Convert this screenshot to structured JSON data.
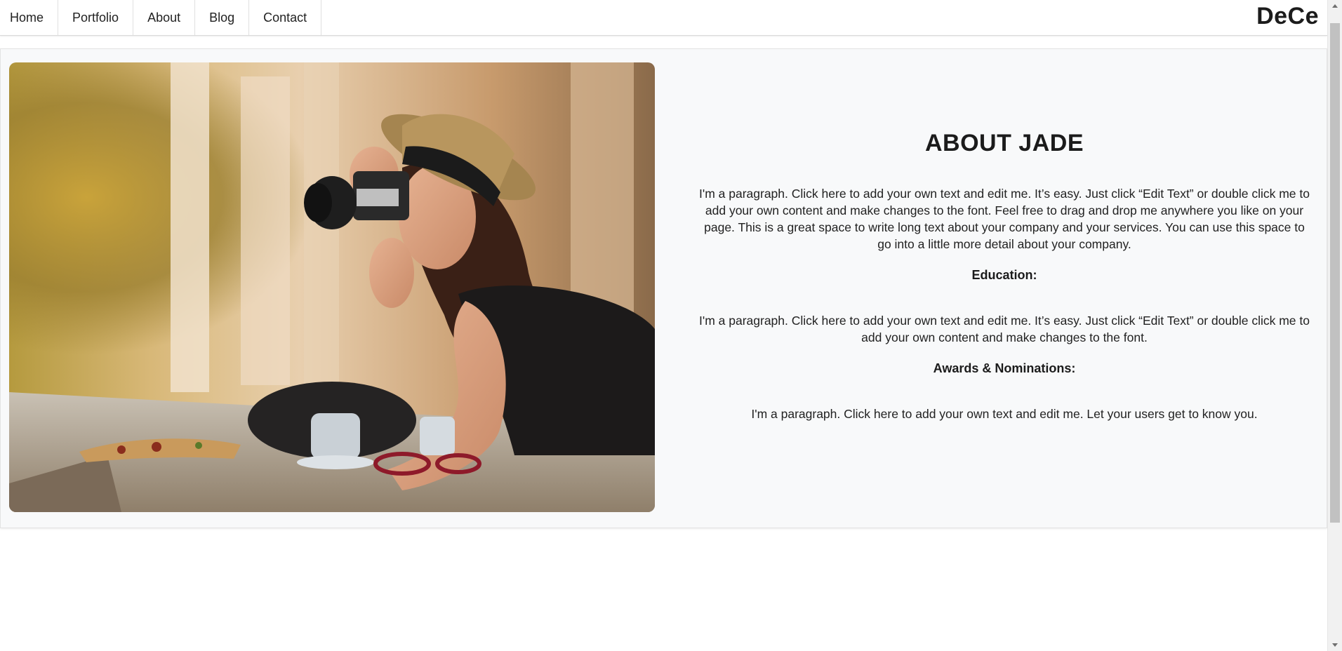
{
  "nav": {
    "items": [
      {
        "label": "Home"
      },
      {
        "label": "Portfolio"
      },
      {
        "label": "About"
      },
      {
        "label": "Blog"
      },
      {
        "label": "Contact"
      }
    ],
    "brand": "DeCe"
  },
  "about": {
    "title": "ABOUT JADE",
    "intro": "I'm a paragraph. Click here to add your own text and edit me. It’s easy. Just click “Edit Text” or double click me to add your own content and make changes to the font. Feel free to drag and drop me anywhere you like on your page. This is a great space to write long text about your company and your services. You can use this space to go into a little more detail about your company.",
    "education_heading": "Education:",
    "education_text": "I'm a paragraph. Click here to add your own text and edit me. It’s easy. Just click “Edit Text” or double click me to add your own content and make changes to the font.",
    "awards_heading": "Awards & Nominations:",
    "awards_text": "I'm a paragraph. Click here to add your own text and edit me. Let your users get to know you.",
    "photo_icon": "photographer-with-camera-image"
  },
  "colors": {
    "card_background": "#f8f9fa",
    "text": "#222222",
    "nav_border": "#e0e0e0"
  }
}
